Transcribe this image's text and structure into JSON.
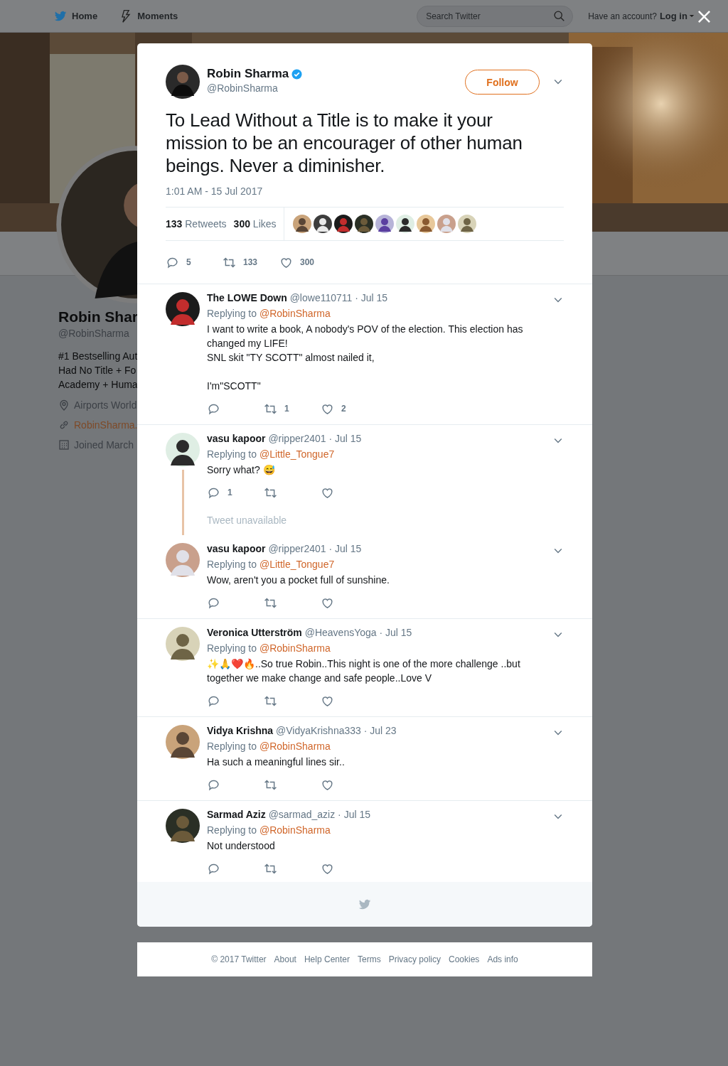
{
  "nav": {
    "items": [
      {
        "label": "Home",
        "kind": "bird"
      },
      {
        "label": "Moments",
        "kind": "moments"
      }
    ],
    "search": {
      "placeholder": "Search Twitter"
    },
    "account_prompt": "Have an account?",
    "login": "Log in"
  },
  "profile": {
    "name": "Robin Shar",
    "handle": "@RobinSharma",
    "bio_lines": [
      "#1 Bestselling Aut",
      "Had No Title + Fo",
      "Academy + Huma"
    ],
    "location": "Airports World",
    "website": "RobinSharma.",
    "joined": "Joined March"
  },
  "tweet": {
    "author": "Robin Sharma",
    "verified": true,
    "handle": "@RobinSharma",
    "follow": "Follow",
    "text": "To Lead Without a Title is to make it your mission to be an encourager of other human beings. Never a diminisher.",
    "timestamp": "1:01 AM - 15 Jul 2017",
    "retweets_count": "133",
    "retweets_label": "Retweets",
    "likes_count": "300",
    "likes_label": "Likes",
    "actions": {
      "replies": "5",
      "retweets": "133",
      "likes": "300"
    }
  },
  "reply_groups": [
    {
      "tweets": [
        {
          "kind": "tweet",
          "name": "The LOWE Down",
          "meta": "@lowe110711 · Jul 15",
          "replying_label": "Replying to",
          "replying_to": "@RobinSharma",
          "text": "I want to write a book, A nobody's POV of the election. This election has changed my LIFE!\nSNL skit \"TY SCOTT\" almost nailed it,\n\nI'm\"SCOTT\"",
          "actions": {
            "retweets": "1",
            "likes": "2"
          }
        }
      ]
    },
    {
      "tweets": [
        {
          "kind": "tweet",
          "name": "vasu kapoor",
          "meta": "@ripper2401 · Jul 15",
          "replying_label": "Replying to",
          "replying_to": "@Little_Tongue7",
          "text": "Sorry what? 😅",
          "actions": {
            "replies": "1"
          }
        },
        {
          "kind": "unavailable",
          "text": "Tweet unavailable"
        },
        {
          "kind": "tweet",
          "name": "vasu kapoor",
          "meta": "@ripper2401 · Jul 15",
          "replying_label": "Replying to",
          "replying_to": "@Little_Tongue7",
          "text": "Wow, aren't you a pocket full of sunshine."
        }
      ]
    },
    {
      "tweets": [
        {
          "kind": "tweet",
          "name": "Veronica Utterström",
          "meta": "@HeavensYoga · Jul 15",
          "replying_label": "Replying to",
          "replying_to": "@RobinSharma",
          "text": "✨🙏❤️🔥..So true Robin..This night is one of the more challenge ..but together we make change and safe people..Love V"
        }
      ]
    },
    {
      "tweets": [
        {
          "kind": "tweet",
          "name": "Vidya Krishna",
          "meta": "@VidyaKrishna333 · Jul 23",
          "replying_label": "Replying to",
          "replying_to": "@RobinSharma",
          "text": "Ha such a meaningful lines sir.."
        }
      ]
    },
    {
      "tweets": [
        {
          "kind": "tweet",
          "name": "Sarmad Aziz",
          "meta": "@sarmad_aziz · Jul 15",
          "replying_label": "Replying to",
          "replying_to": "@RobinSharma",
          "text": "Not understood"
        }
      ]
    }
  ],
  "footer_links": [
    "© 2017 Twitter",
    "About",
    "Help Center",
    "Terms",
    "Privacy policy",
    "Cookies",
    "Ads info"
  ]
}
